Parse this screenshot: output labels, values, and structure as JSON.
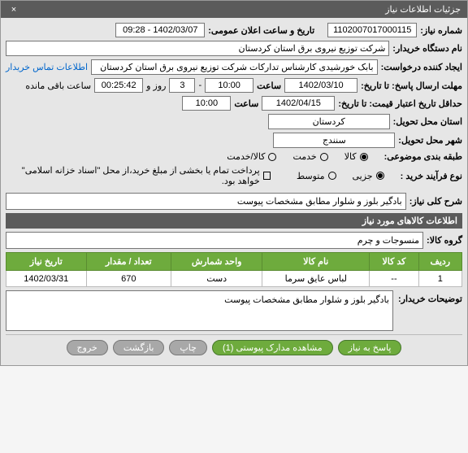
{
  "title": "جزئیات اطلاعات نیاز",
  "labels": {
    "need_no": "شماره نیاز:",
    "pub_datetime": "تاریخ و ساعت اعلان عمومی:",
    "buyer": "نام دستگاه خریدار:",
    "creator": "ایجاد کننده درخواست:",
    "contact": "اطلاعات تماس خریدار",
    "deadline_send": "مهلت ارسال پاسخ: تا تاریخ:",
    "time_label": "ساعت",
    "dash": "-",
    "days": "روز و",
    "remaining": "ساعت باقی مانده",
    "validity": "حداقل تاریخ اعتبار قیمت: تا تاریخ:",
    "province": "استان محل تحویل:",
    "city": "شهر محل تحویل:",
    "category": "طبقه بندی موضوعی:",
    "cat_kala": "کالا",
    "cat_khadamat": "خدمت",
    "cat_both": "کالا/خدمت",
    "purchase_type": "نوع فرآیند خرید :",
    "pt_small": "جزیی",
    "pt_medium": "متوسط",
    "pt_checkbox": "پرداخت تمام یا بخشی از مبلغ خرید،از محل \"اسناد خزانه اسلامی\" خواهد بود.",
    "desc_label": "شرح کلی نیاز:",
    "goods_section": "اطلاعات کالاهای مورد نیاز",
    "group_label": "گروه کالا:",
    "notes_label": "توضیحات خریدار:"
  },
  "values": {
    "need_no": "1102007017000115",
    "pub_date": "1402/03/07 - 09:28",
    "buyer": "شرکت توزیع نیروی برق استان کردستان",
    "creator": "بابک خورشیدی کارشناس تدارکات شرکت توزیع نیروی برق استان کردستان",
    "deadline_date": "1402/03/10",
    "deadline_time": "10:00",
    "days": "3",
    "countdown": "00:25:42",
    "validity_date": "1402/04/15",
    "validity_time": "10:00",
    "province": "کردستان",
    "city": "سنندج",
    "desc": "بادگیر بلوز و شلوار مطابق مشخصات پیوست",
    "group": "منسوجات و چرم",
    "notes": "بادگیر بلوز و شلوار مطابق مشخصات پیوست"
  },
  "table": {
    "headers": {
      "row": "ردیف",
      "code": "کد کالا",
      "name": "نام کالا",
      "unit": "واحد شمارش",
      "qty": "تعداد / مقدار",
      "date": "تاریخ نیاز"
    },
    "rows": [
      {
        "row": "1",
        "code": "--",
        "name": "لباس عایق سرما",
        "unit": "دست",
        "qty": "670",
        "date": "1402/03/31"
      }
    ]
  },
  "buttons": {
    "respond": "پاسخ به نیاز",
    "attachments": "مشاهده مدارک پیوستی (1)",
    "print": "چاپ",
    "back": "بازگشت",
    "exit": "خروج"
  }
}
